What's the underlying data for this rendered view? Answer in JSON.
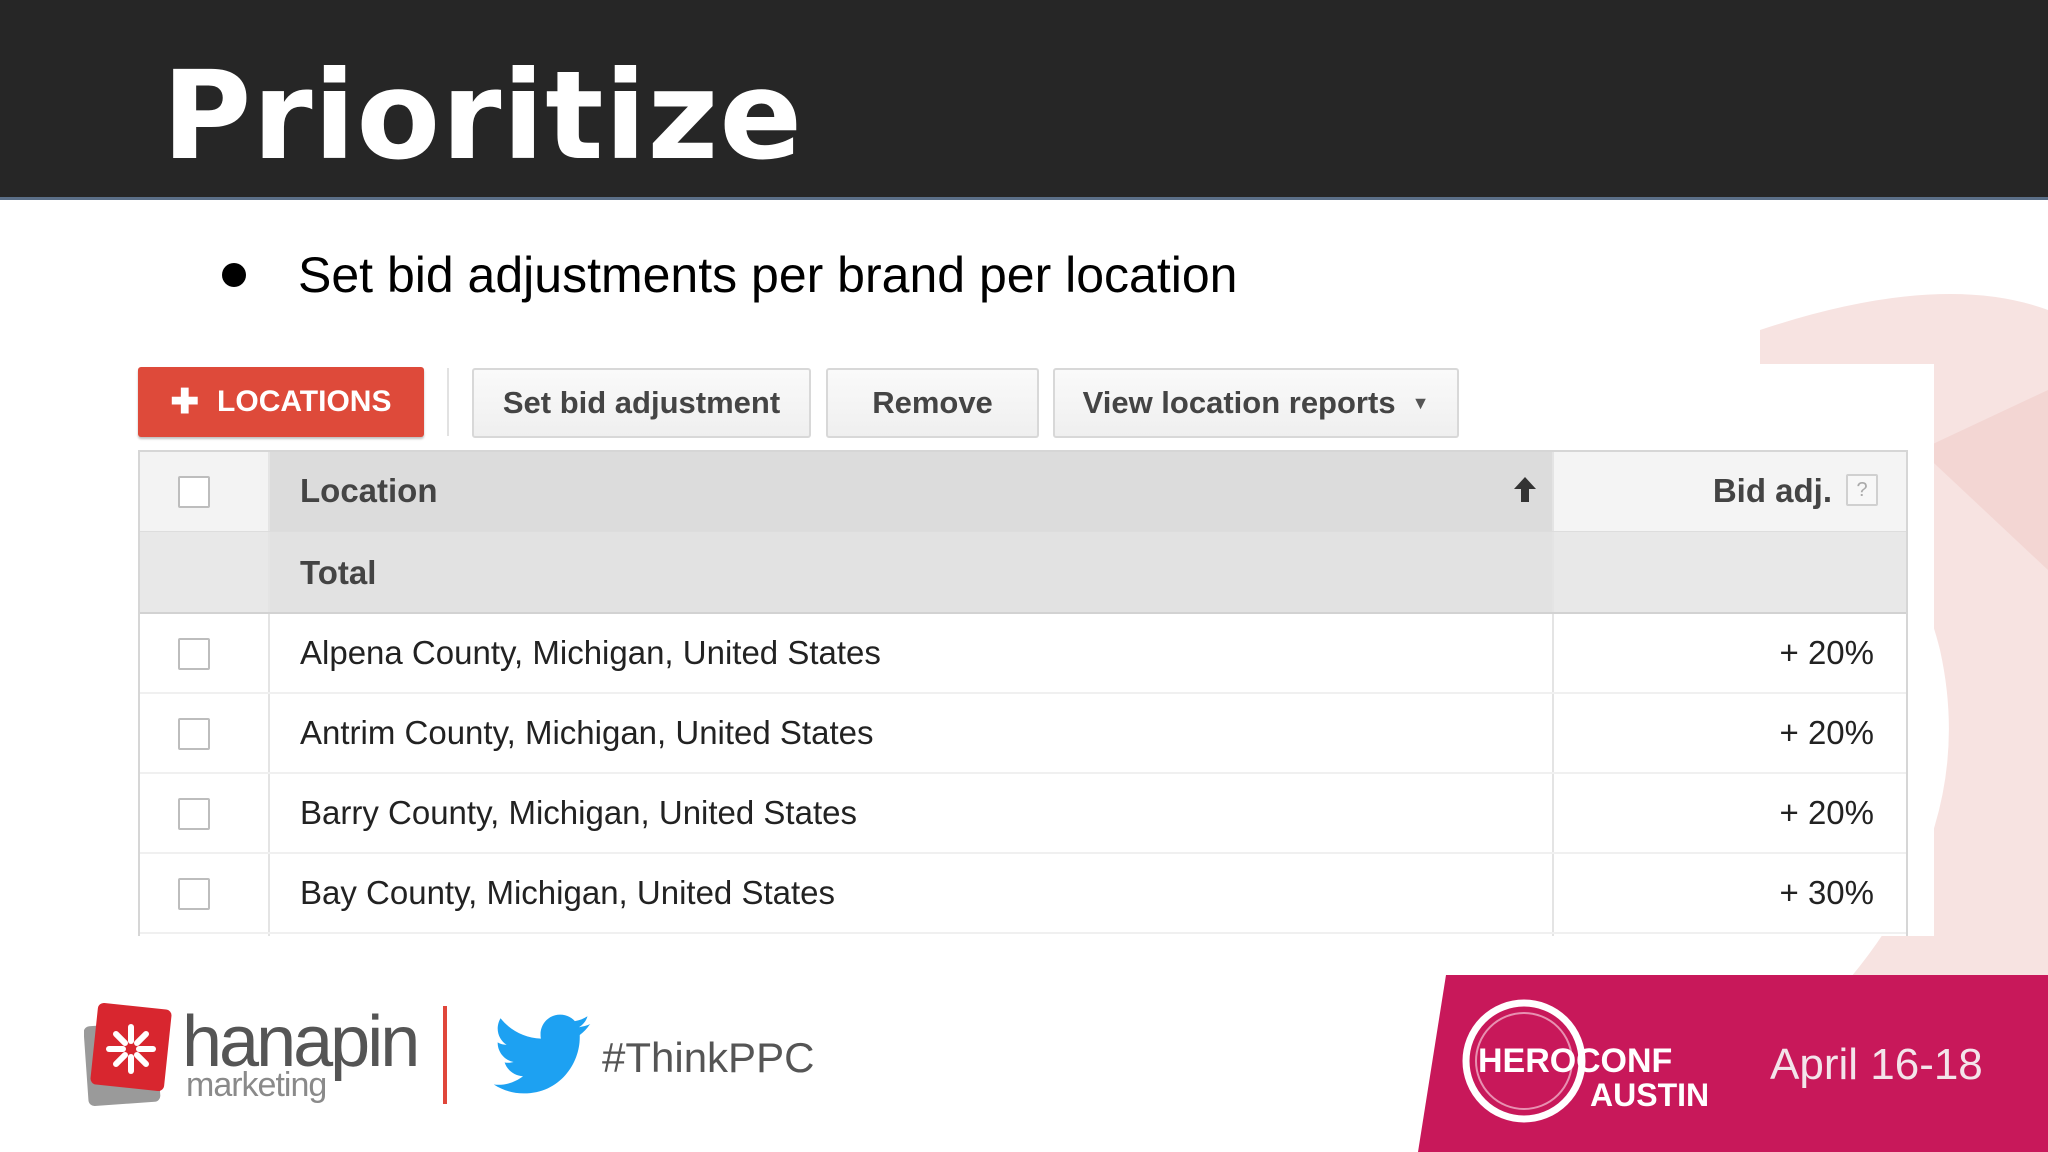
{
  "slide": {
    "title": "Prioritize",
    "bullet": "Set bid adjustments per brand per location"
  },
  "toolbar": {
    "add_locations_icon": "plus-icon",
    "add_locations_label": "LOCATIONS",
    "set_bid_label": "Set bid adjustment",
    "remove_label": "Remove",
    "view_reports_label": "View location reports",
    "view_reports_icon": "caret-down-icon"
  },
  "table": {
    "columns": {
      "location": "Location",
      "bid_adj": "Bid adj.",
      "help_glyph": "?",
      "sort_icon": "arrow-up-icon"
    },
    "total_label": "Total",
    "rows": [
      {
        "location": "Alpena County, Michigan, United States",
        "bid_adj": "+ 20%"
      },
      {
        "location": "Antrim County, Michigan, United States",
        "bid_adj": "+ 20%"
      },
      {
        "location": "Barry County, Michigan, United States",
        "bid_adj": "+ 20%"
      },
      {
        "location": "Bay County, Michigan, United States",
        "bid_adj": "+ 30%"
      }
    ]
  },
  "footer": {
    "brand_name": "hanapin",
    "brand_sub": "marketing",
    "hashtag": "#ThinkPPC",
    "conference_logo_text": [
      "HERO",
      "CONF",
      "AUSTIN"
    ],
    "conference_dates": "April 16-18"
  },
  "colors": {
    "header_bg": "#262626",
    "accent_red": "#de4a3a",
    "conference_magenta": "#c8185a",
    "twitter_blue": "#1da1f2"
  }
}
